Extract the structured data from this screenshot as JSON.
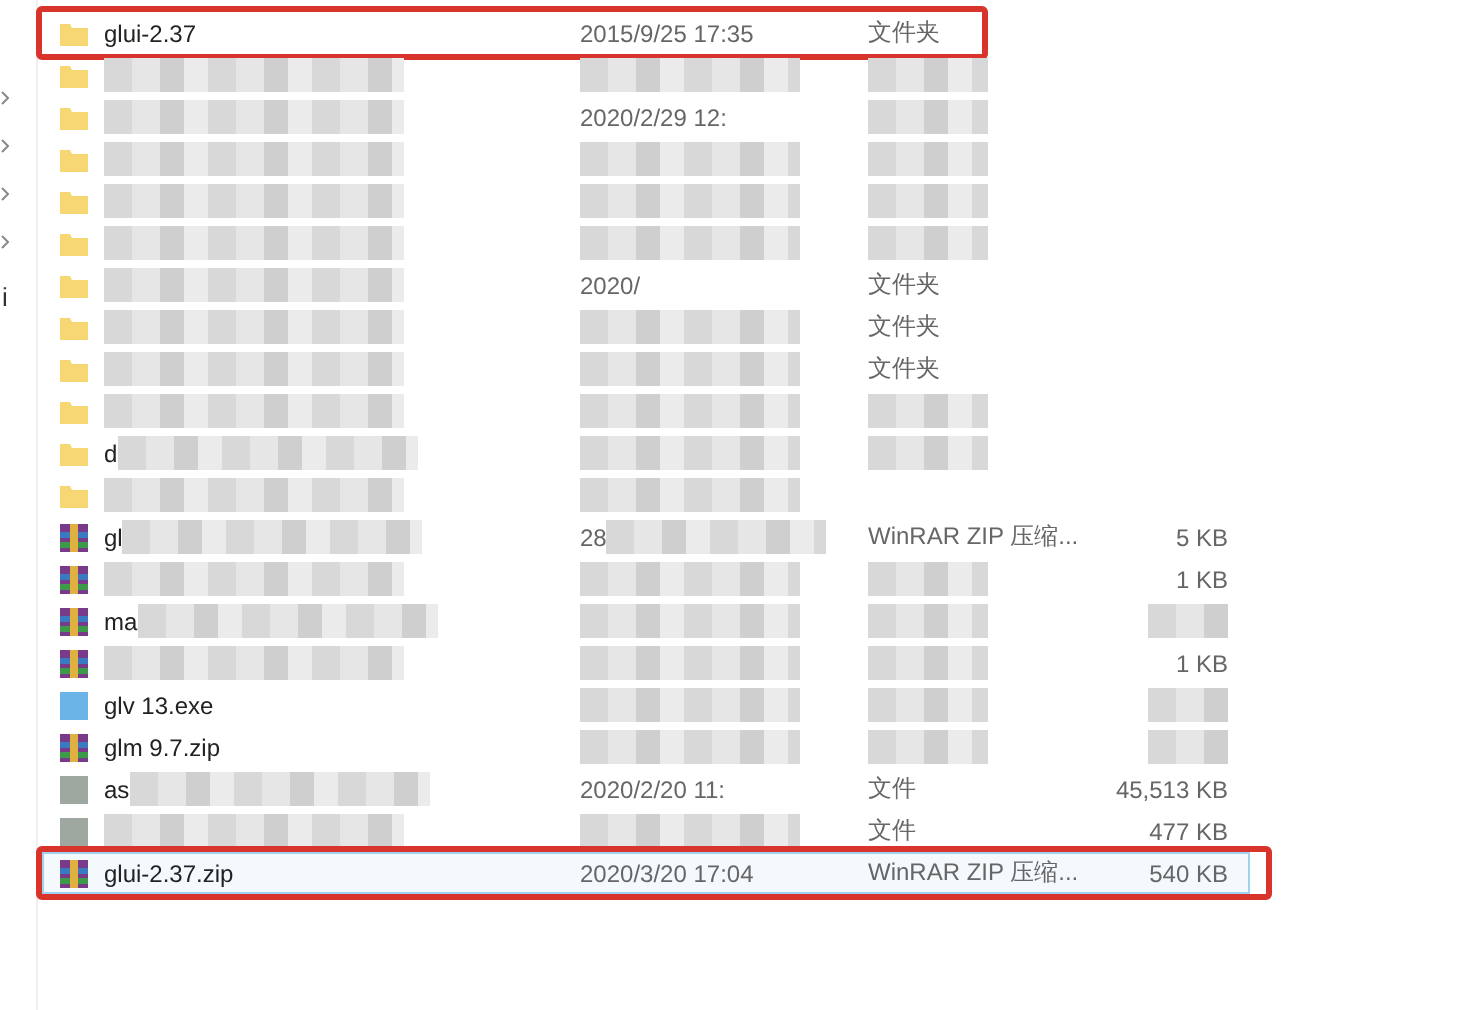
{
  "sidebar": {
    "fragment": "i"
  },
  "rows": [
    {
      "kind": "folder",
      "name": "glui-2.37",
      "date": "2015/9/25 17:35",
      "type": "文件夹",
      "selected": false,
      "highlighted": true,
      "highlight_wide": false
    },
    {
      "kind": "folder",
      "selected": false,
      "name_obscured": true,
      "date_obscured": true,
      "type_obscured": true
    },
    {
      "kind": "folder",
      "date": "2020/2/29 12:",
      "selected": false,
      "name_obscured": true,
      "type_obscured": true
    },
    {
      "kind": "folder",
      "selected": false,
      "name_obscured": true,
      "date_obscured": true,
      "type_obscured": true
    },
    {
      "kind": "folder",
      "selected": false,
      "name_obscured": true,
      "date_obscured": true,
      "type_obscured": true
    },
    {
      "kind": "folder",
      "selected": false,
      "name_obscured": true,
      "date_obscured": true,
      "type_obscured": true
    },
    {
      "kind": "folder",
      "date": "2020/",
      "type": "文件夹",
      "selected": false,
      "name_obscured": true
    },
    {
      "kind": "folder",
      "type": "文件夹",
      "selected": false,
      "name_obscured": true,
      "date_obscured": true
    },
    {
      "kind": "folder",
      "type": "文件夹",
      "selected": false,
      "name_obscured": true,
      "date_obscured": true
    },
    {
      "kind": "folder",
      "selected": false,
      "name_obscured": true,
      "date_obscured": true,
      "type_obscured": true
    },
    {
      "kind": "folder",
      "name": "d",
      "selected": false,
      "name_obscured": true,
      "date_obscured": true,
      "type_obscured": true
    },
    {
      "kind": "folder",
      "selected": false,
      "name_obscured": true,
      "date_obscured": true
    },
    {
      "kind": "archive",
      "name": "gl",
      "date": "28",
      "type": "WinRAR ZIP 压缩...",
      "size": "5 KB",
      "selected": false,
      "name_obscured": true,
      "date_obscured": true
    },
    {
      "kind": "archive",
      "size": "1 KB",
      "selected": false,
      "name_obscured": true,
      "date_obscured": true,
      "type_obscured": true
    },
    {
      "kind": "archive",
      "name": "ma",
      "selected": false,
      "name_obscured": true,
      "date_obscured": true,
      "type_obscured": true,
      "size_obscured": true
    },
    {
      "kind": "archive",
      "size": "1 KB",
      "selected": false,
      "name_obscured": true,
      "date_obscured": true,
      "type_obscured": true
    },
    {
      "kind": "exe",
      "name": "glv 13.exe",
      "selected": false,
      "date_obscured": true,
      "type_obscured": true,
      "size_obscured": true
    },
    {
      "kind": "archive",
      "name": "glm 9.7.zip",
      "selected": false,
      "date_obscured": true,
      "type_obscured": true,
      "size_obscured": true
    },
    {
      "kind": "file",
      "name": "as",
      "date": "2020/2/20 11:",
      "type": "文件",
      "size": "45,513 KB",
      "selected": false,
      "name_obscured": true
    },
    {
      "kind": "file",
      "type": "文件",
      "size": "477 KB",
      "selected": false,
      "name_obscured": true,
      "date_obscured": true
    },
    {
      "kind": "archive",
      "name": "glui-2.37.zip",
      "date": "2020/3/20 17:04",
      "type": "WinRAR ZIP 压缩...",
      "size": "540 KB",
      "selected": true,
      "highlighted": true,
      "highlight_wide": true
    }
  ]
}
